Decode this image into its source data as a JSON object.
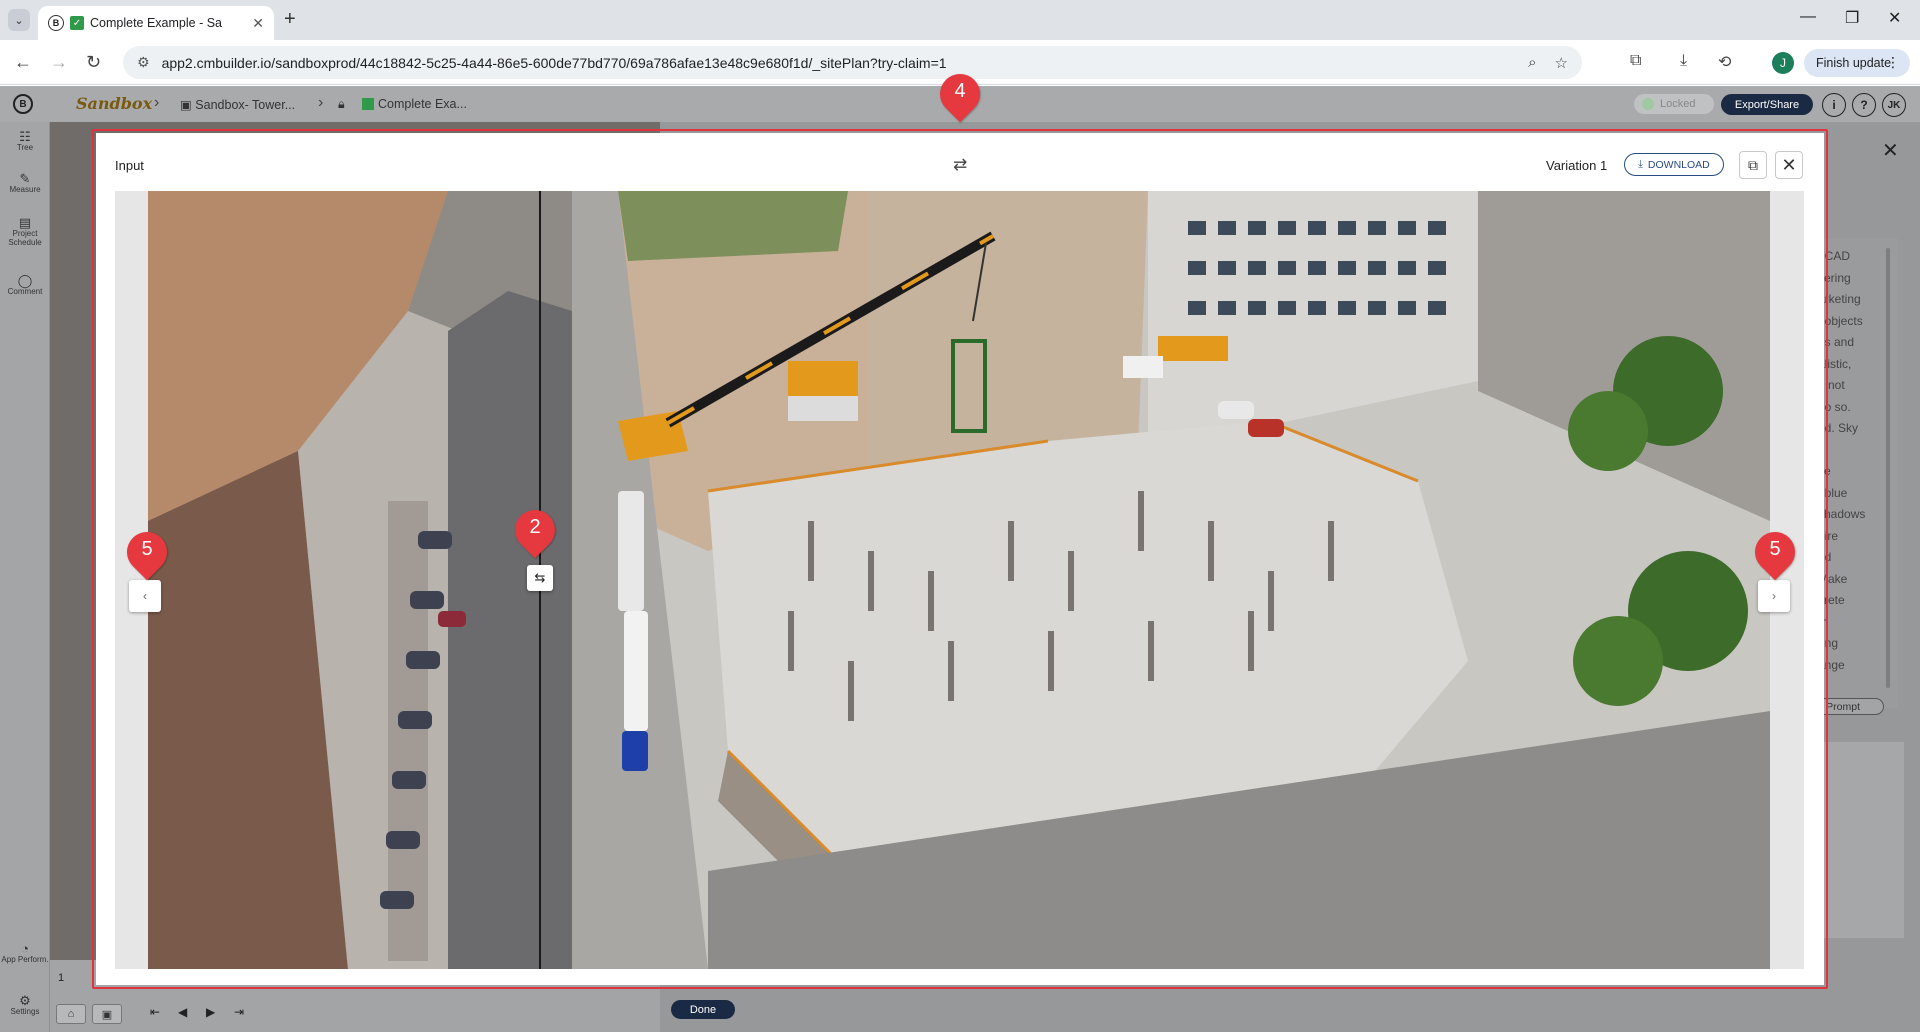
{
  "browser": {
    "tab_title": "Complete Example - Sa",
    "url": "app2.cmbuilder.io/sandboxprod/44c18842-5c25-4a44-86e5-600de77bd770/69a786afae13e48c9e680f1d/_sitePlan?try-claim=1",
    "profile_initial": "J",
    "finish_update_label": "Finish update"
  },
  "app": {
    "logo_text": "Sandbox",
    "breadcrumbs": [
      "Sandbox- Tower...",
      "Complete Exa..."
    ],
    "locked_label": "Locked",
    "export_label": "Export/Share",
    "user_initials": "JK",
    "sidebar": [
      {
        "label": "Tree",
        "icon": "tree-icon"
      },
      {
        "label": "Measure",
        "icon": "measure-icon"
      },
      {
        "label": "Project Schedule",
        "icon": "schedule-icon"
      },
      {
        "label": "Comment",
        "icon": "comment-icon"
      },
      {
        "label": "App Perform.",
        "icon": "app-performance-icon"
      },
      {
        "label": "Settings",
        "icon": "settings-icon"
      }
    ],
    "right_panel_text": ": CAD\ncering\narketing\nf objects\nes and\nalistic,\nd not\ndo so.\ned. Sky\n\nite\nt blue\nshadows\nbire\nnd\nMake\ncrete\nth\nring\nange",
    "edit_prompt_label": "it Prompt",
    "timeline_frame": "1",
    "done_label": "Done"
  },
  "modal": {
    "input_label": "Input",
    "variation_label": "Variation 1",
    "download_label": "DOWNLOAD"
  },
  "annotations": [
    "4",
    "2",
    "5",
    "5"
  ],
  "colors": {
    "annotation_red": "#e5393f",
    "primary_navy": "#1b2a44",
    "download_blue": "#2a4c7e"
  }
}
